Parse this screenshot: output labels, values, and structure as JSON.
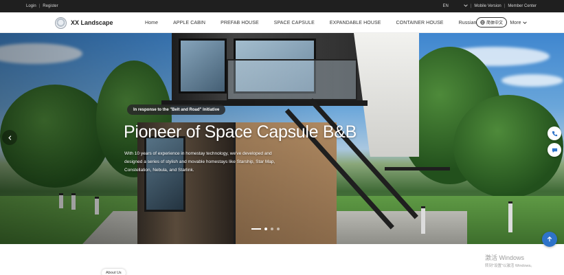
{
  "topbar": {
    "login": "Login",
    "register": "Register",
    "language": "EN",
    "mobile_version": "Mobile Version",
    "member_center": "Member Center"
  },
  "brand": {
    "name": "XX Landscape"
  },
  "nav": {
    "items": [
      "Home",
      "APPLE CABIN",
      "PREFAB HOUSE",
      "SPACE CAPSULE",
      "EXPANDABLE HOUSE",
      "CONTAINER HOUSE",
      "Russian Column"
    ],
    "more": "More",
    "chinese_button": "简体中文"
  },
  "hero": {
    "tagline": "In response to the \"Belt and Road\" Initiative",
    "title": "Pioneer of Space Capsule B&B",
    "description": "With 10 years of experience in homestay technology, we've developed and designed a series of stylish and movable homestays like Starship, Star Map, Constellation, Nebula, and Starlink.",
    "slides": 3,
    "active_slide": 1
  },
  "about": {
    "label": "About Us"
  },
  "watermark": {
    "line1": "激活 Windows",
    "line2": "转到\"设置\"以激活 Windows。"
  },
  "icons": {
    "logo": "globe-logo-icon",
    "prev": "chevron-left-icon",
    "phone": "phone-icon",
    "chat": "chat-icon",
    "top": "arrow-up-icon",
    "chevron": "chevron-down-icon",
    "globe": "globe-icon"
  },
  "colors": {
    "topbar_bg": "#1f1f1f",
    "accent": "#2e73c9"
  }
}
